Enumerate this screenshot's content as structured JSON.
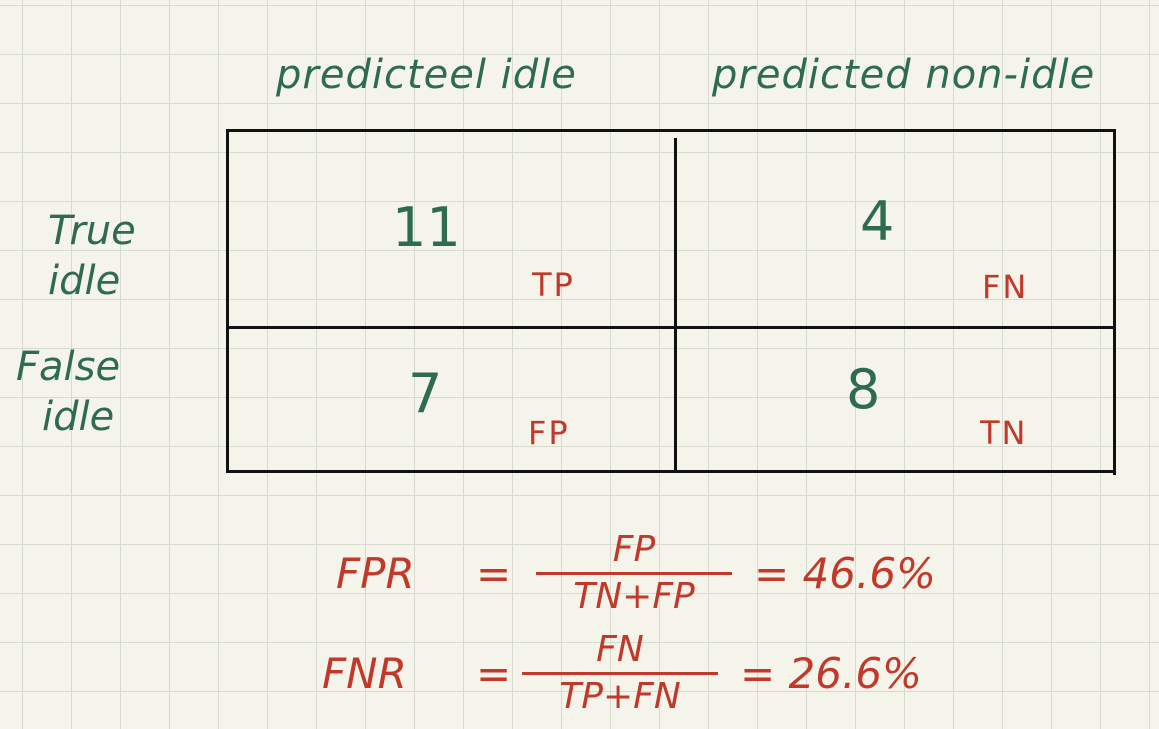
{
  "columns": {
    "col1": "predicteel idle",
    "col2": "predicted non-idle"
  },
  "rows": {
    "row1": [
      "True",
      "idle"
    ],
    "row2": [
      "False",
      "idle"
    ]
  },
  "cells": {
    "tp": {
      "value": "11",
      "tag": "TP"
    },
    "fn": {
      "value": "4",
      "tag": "FN"
    },
    "fp": {
      "value": "7",
      "tag": "FP"
    },
    "tn": {
      "value": "8",
      "tag": "TN"
    }
  },
  "formulas": [
    {
      "lhs": "FPR",
      "eq": "=",
      "numerator": "FP",
      "denominator": "TN+FP",
      "result": "= 46.6%"
    },
    {
      "lhs": "FNR",
      "eq": "=",
      "numerator": "FN",
      "denominator": "TP+FN",
      "result": "= 26.6%"
    }
  ],
  "colors": {
    "green_ink": "#2e6b4f",
    "red_ink": "#c0392b",
    "paper": "#f5f4ea",
    "grid": "#d7dacf"
  }
}
